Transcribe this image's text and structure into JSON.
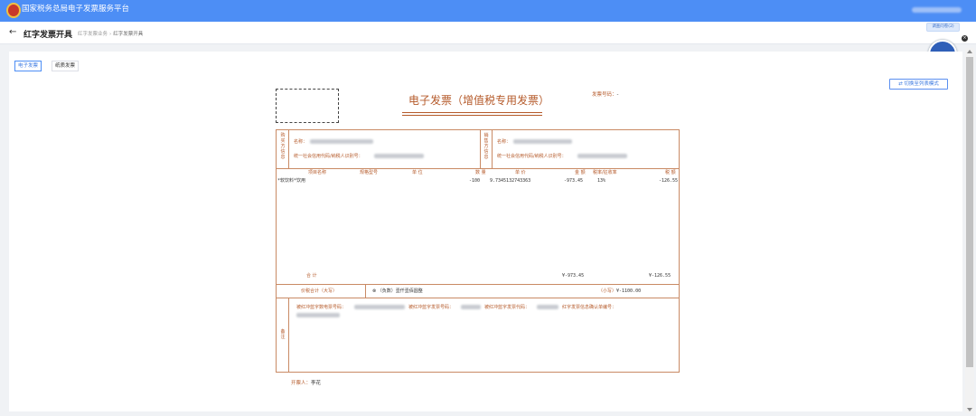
{
  "app": {
    "title": "国家税务总局电子发票服务平台"
  },
  "page": {
    "back_icon": "←",
    "title": "红字发票开具"
  },
  "breadcrumb": {
    "items": [
      "红字发票业务",
      "红字发票开具"
    ],
    "separator": "›"
  },
  "help_button": {
    "label": "调查问卷(2)",
    "close": "×"
  },
  "tabs": [
    {
      "label": "电子发票",
      "active": true
    },
    {
      "label": "纸质发票",
      "active": false
    }
  ],
  "switch_mode": {
    "label": "切换至列表模式",
    "icon": "swap-icon"
  },
  "invoice": {
    "title": "电子发票（增值税专用发票）",
    "number_label": "发票号码：",
    "number_value": "-",
    "buyer": {
      "side_label": "购买方信息",
      "name_label": "名称：",
      "taxid_label": "统一社会信用代码/纳税人识别号："
    },
    "seller": {
      "side_label": "销售方信息",
      "name_label": "名称：",
      "taxid_label": "统一社会信用代码/纳税人识别号："
    },
    "columns": [
      "项目名称",
      "规格型号",
      "单 位",
      "数 量",
      "单 价",
      "金 额",
      "税率/征收率",
      "税 额"
    ],
    "rows": [
      {
        "name": "*软饮料*饮用",
        "spec": "",
        "unit": "",
        "qty": "-100",
        "price": "9.7345132743363",
        "amount": "-973.45",
        "rate": "13%",
        "tax": "-126.55"
      }
    ],
    "subtotal": {
      "label": "合 计",
      "amount": "¥-973.45",
      "tax": "¥-126.55"
    },
    "total": {
      "label": "价税合计（大写）",
      "words": "（负数）壹仟壹佰圆整",
      "small_label": "（小写）",
      "small_value": "¥-1100.00"
    },
    "remarks": {
      "side_label": "备注",
      "line1": [
        "被红冲蓝字数电票号码：",
        "被红冲蓝字发票号码：",
        "被红冲蓝字发票代码：",
        "红字发票信息确认单编号："
      ]
    },
    "issuer_label": "开票人：",
    "issuer_name": "李花"
  },
  "colors": {
    "topbar": "#4d8ef5",
    "invoice_accent": "#b55a2a",
    "invoice_border": "#c98a64"
  }
}
